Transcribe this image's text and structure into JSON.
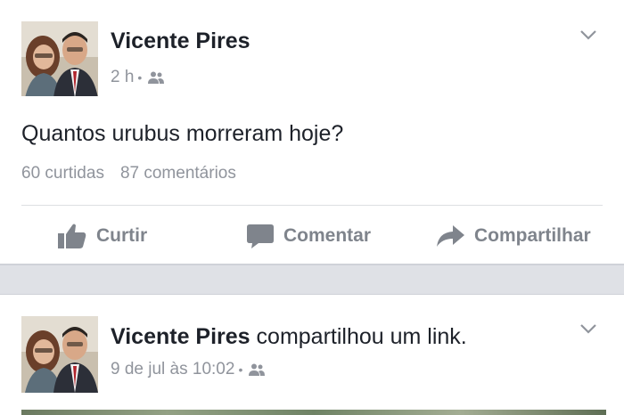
{
  "post1": {
    "author": "Vicente Pires",
    "time": "2 h",
    "text": "Quantos urubus morreram hoje?",
    "likes": "60 curtidas",
    "comments": "87 comentários",
    "actions": {
      "like": "Curtir",
      "comment": "Comentar",
      "share": "Compartilhar"
    }
  },
  "post2": {
    "author": "Vicente Pires",
    "action_text": "compartilhou um link.",
    "time": "9 de jul às 10:02"
  },
  "icons": {
    "privacy": "friends-icon",
    "menu": "chevron-down-icon",
    "like": "thumbs-up-icon",
    "comment": "speech-bubble-icon",
    "share": "share-arrow-icon"
  },
  "colors": {
    "page_background": "#dfe1e6",
    "card_background": "#ffffff",
    "primary_text": "#1d2129",
    "secondary_text": "#90949c",
    "action_text": "#7f848c"
  }
}
